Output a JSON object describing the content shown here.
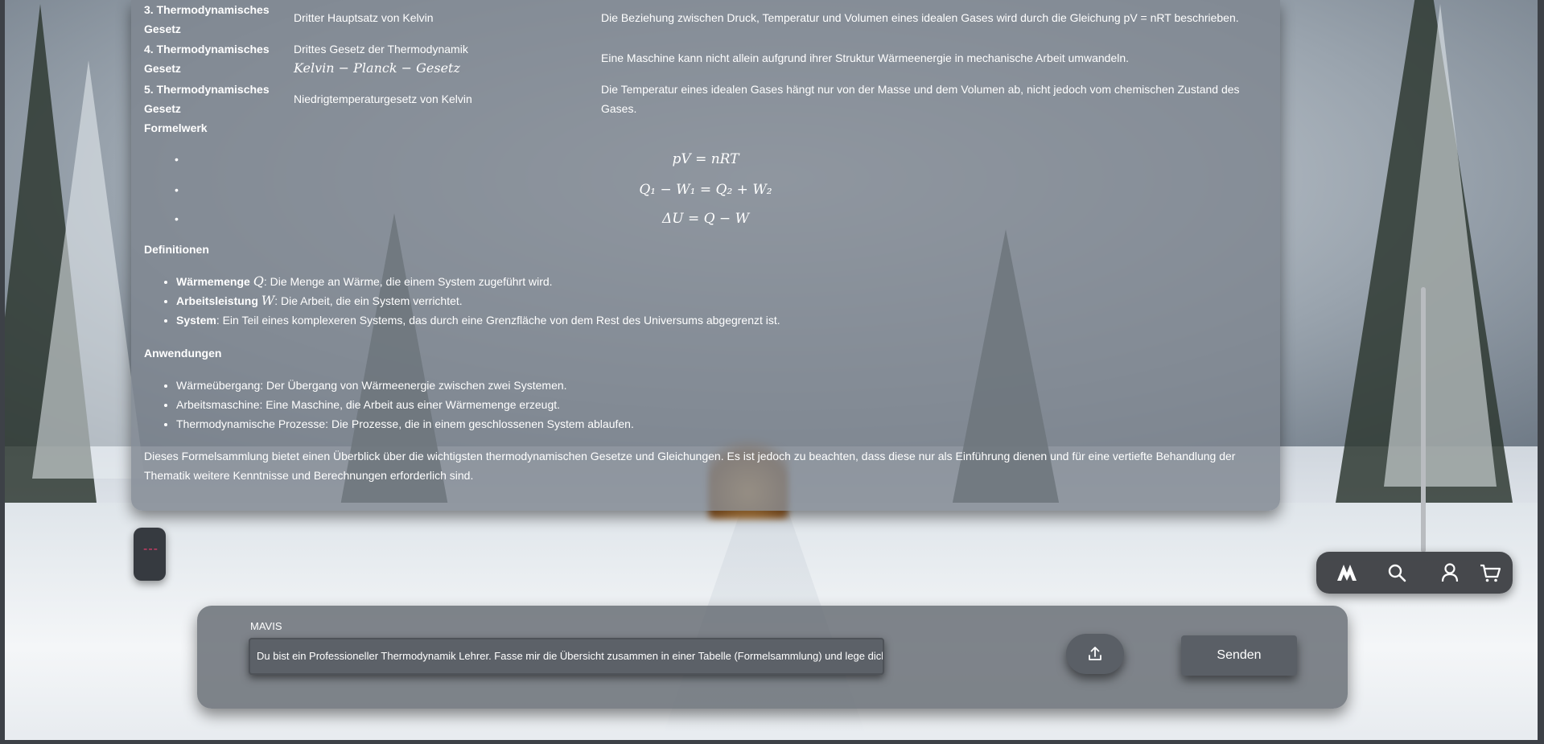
{
  "table_rows": [
    {
      "c1": "3. Thermodynamisches Gesetz",
      "c2": "Dritter Hauptsatz von Kelvin",
      "c3": "Die Beziehung zwischen Druck, Temperatur und Volumen eines idealen Gases wird durch die Gleichung pV = nRT beschrieben."
    },
    {
      "c1": "4. Thermodynamisches Gesetz",
      "c2": "Drittes Gesetz der Thermodynamik",
      "c2_math": "Kelvin − Planck − Gesetz",
      "c3": "Eine Maschine kann nicht allein aufgrund ihrer Struktur Wärmeenergie in mechanische Arbeit umwandeln."
    },
    {
      "c1": "5. Thermodynamisches Gesetz",
      "c2": "Niedrigtemperaturgesetz von Kelvin",
      "c3": "Die Temperatur eines idealen Gases hängt nur von der Masse und dem Volumen ab, nicht jedoch vom chemischen Zustand des Gases."
    }
  ],
  "formelwerk_heading": "Formelwerk",
  "formulas": [
    "pV = nRT",
    "Q₁ − W₁ = Q₂ + W₂",
    "ΔU = Q − W"
  ],
  "definitionen_heading": "Definitionen",
  "definitionen": [
    {
      "term": "Wärmemenge",
      "symbol": "Q",
      "text": ": Die Menge an Wärme, die einem System zugeführt wird."
    },
    {
      "term": "Arbeitsleistung",
      "symbol": "W",
      "text": ": Die Arbeit, die ein System verrichtet."
    },
    {
      "term": "System",
      "symbol": "",
      "text": ": Ein Teil eines komplexeren Systems, das durch eine Grenzfläche von dem Rest des Universums abgegrenzt ist."
    }
  ],
  "anwendungen_heading": "Anwendungen",
  "anwendungen": [
    "Wärmeübergang: Der Übergang von Wärmeenergie zwischen zwei Systemen.",
    "Arbeitsmaschine: Eine Maschine, die Arbeit aus einer Wärmemenge erzeugt.",
    "Thermodynamische Prozesse: Die Prozesse, die in einem geschlossenen System ablaufen."
  ],
  "summary": "Dieses Formelsammlung bietet einen Überblick über die wichtigsten thermodynamischen Gesetze und Gleichungen. Es ist jedoch zu beachten, dass diese nur als Einführung dienen und für eine vertiefte Behandlung der Thematik weitere Kenntnisse und Berechnungen erforderlich sind.",
  "side_tab": {
    "glyph": "---"
  },
  "nav": {
    "icons": [
      "logo-icon",
      "search-icon",
      "user-icon",
      "cart-icon"
    ]
  },
  "composer": {
    "label": "MAVIS",
    "input_value": "Du bist ein Professioneller Thermodynamik Lehrer. Fasse mir die Übersicht zusammen in einer Tabelle (Formelsammlung) und lege dich ins Zeug!",
    "send_label": "Senden",
    "upload_icon": "upload-icon"
  },
  "colors": {
    "accent_pink": "#e23d6b",
    "panel": "#7d858f",
    "nav_bg": "#373a3e"
  }
}
